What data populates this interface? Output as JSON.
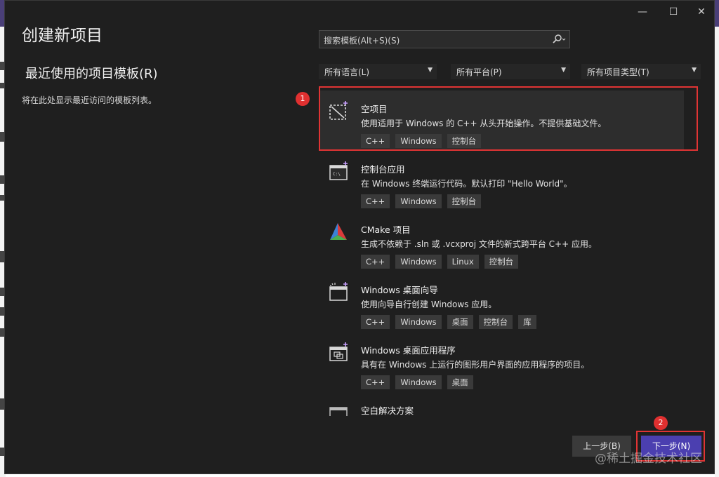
{
  "dialog": {
    "title": "创建新项目",
    "controls": {
      "minimize": "—",
      "maximize": "☐",
      "close": "✕"
    }
  },
  "recent": {
    "heading": "最近使用的项目模板(R)",
    "empty_text": "将在此处显示最近访问的模板列表。"
  },
  "search": {
    "placeholder": "搜索模板(Alt+S)(S)",
    "icon": "search-icon"
  },
  "filters": [
    {
      "label": "所有语言(L)"
    },
    {
      "label": "所有平台(P)"
    },
    {
      "label": "所有项目类型(T)"
    }
  ],
  "templates": [
    {
      "name": "空项目",
      "desc": "使用适用于 Windows 的 C++ 从头开始操作。不提供基础文件。",
      "tags": [
        "C++",
        "Windows",
        "控制台"
      ],
      "icon": "empty-project-icon",
      "selected": true
    },
    {
      "name": "控制台应用",
      "desc": "在 Windows 终端运行代码。默认打印 \"Hello World\"。",
      "tags": [
        "C++",
        "Windows",
        "控制台"
      ],
      "icon": "console-app-icon"
    },
    {
      "name": "CMake 项目",
      "desc": "生成不依赖于 .sln 或 .vcxproj 文件的新式跨平台 C++ 应用。",
      "tags": [
        "C++",
        "Windows",
        "Linux",
        "控制台"
      ],
      "icon": "cmake-icon"
    },
    {
      "name": "Windows 桌面向导",
      "desc": "使用向导自行创建 Windows 应用。",
      "tags": [
        "C++",
        "Windows",
        "桌面",
        "控制台",
        "库"
      ],
      "icon": "desktop-wizard-icon"
    },
    {
      "name": "Windows 桌面应用程序",
      "desc": "具有在 Windows 上运行的图形用户界面的应用程序的项目。",
      "tags": [
        "C++",
        "Windows",
        "桌面"
      ],
      "icon": "desktop-app-icon"
    },
    {
      "name": "空白解决方案",
      "desc": "",
      "tags": [],
      "icon": "blank-solution-icon"
    }
  ],
  "annotations": {
    "badge1": "1",
    "badge2": "2"
  },
  "footer": {
    "prev_label": "上一步(B)",
    "next_label": "下一步(N)"
  },
  "watermark": "@稀土掘金技术社区",
  "colors": {
    "accent": "#4b3fb0",
    "highlight": "#e03434",
    "bg": "#1f1f1f"
  }
}
